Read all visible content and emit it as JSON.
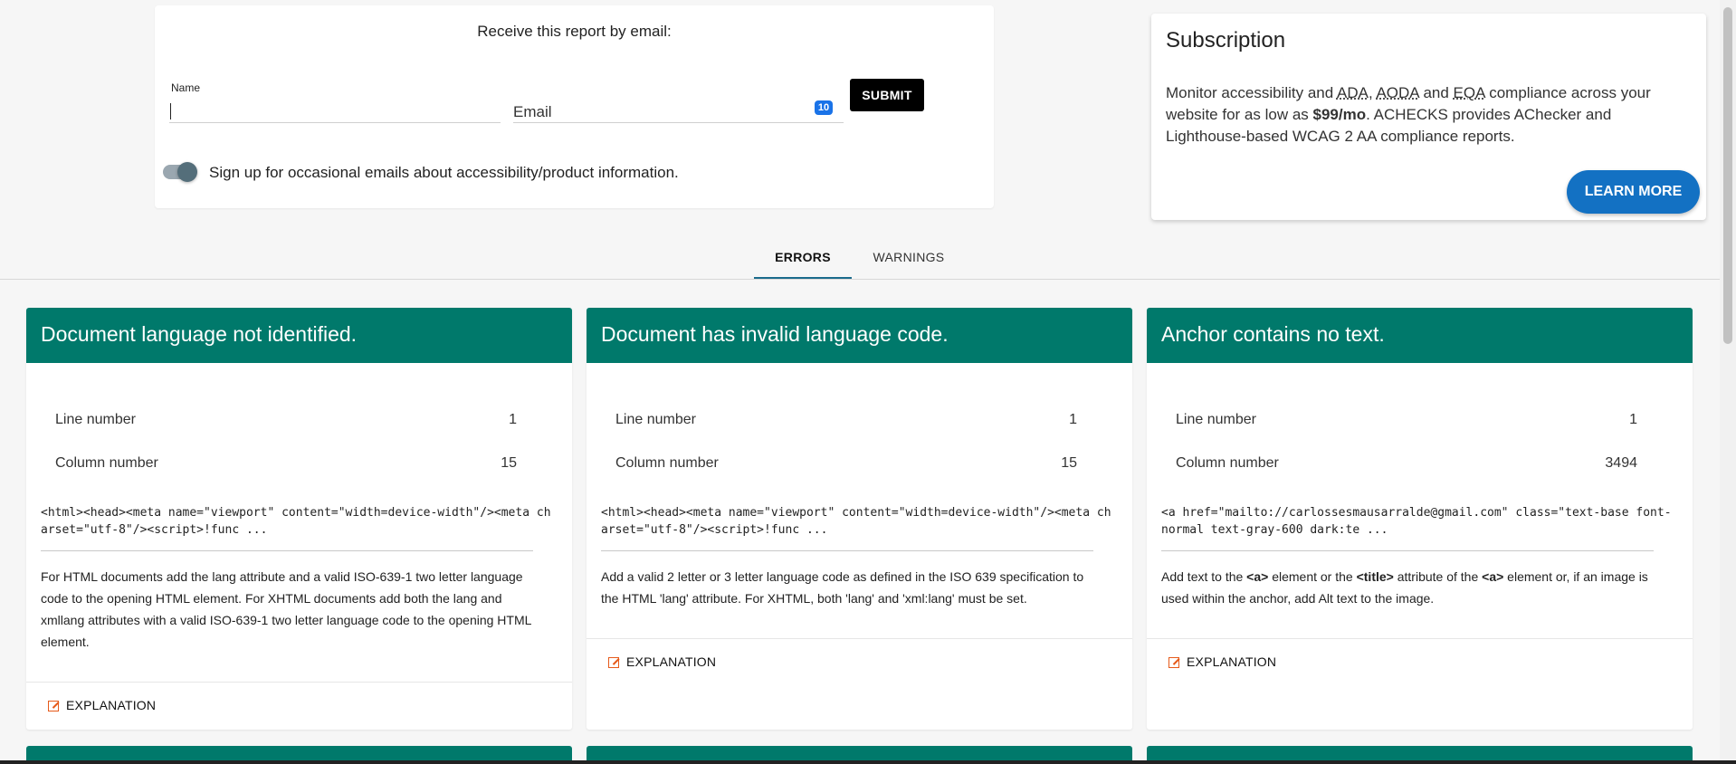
{
  "email_form": {
    "title": "Receive this report by email:",
    "name_label": "Name",
    "email_label": "Email",
    "email_badge": "10",
    "submit_label": "SUBMIT",
    "toggle_on": true,
    "toggle_text": "Sign up for occasional emails about accessibility/product information."
  },
  "subscription": {
    "title": "Subscription",
    "text_1": "Monitor accessibility and ",
    "abbr_ada": "ADA",
    "text_2": ", ",
    "abbr_aoda": "AODA",
    "text_3": " and ",
    "abbr_eqa": "EQA",
    "text_4": " compliance across your website for as low as ",
    "price": "$99/mo",
    "text_5": ". ACHECKS provides AChecker and Lighthouse-based WCAG 2 AA compliance reports.",
    "button_label": "LEARN MORE",
    "button_color": "#1371c3"
  },
  "tabs": [
    {
      "label": "ERRORS",
      "active": true
    },
    {
      "label": "WARNINGS",
      "active": false
    }
  ],
  "errors": [
    {
      "title": "Document language not identified.",
      "line_label": "Line number",
      "line_value": "1",
      "column_label": "Column number",
      "column_value": "15",
      "code": "<html><head><meta name=\"viewport\" content=\"width=device-width\"/><meta charset=\"utf-8\"/><script>!func ...",
      "description": "For HTML documents add the lang attribute and a valid ISO-639-1 two letter language code to the opening HTML element. For XHTML documents add both the lang and xmllang attributes with a valid ISO-639-1 two letter language code to the opening HTML element.",
      "explanation_label": "EXPLANATION"
    },
    {
      "title": "Document has invalid language code.",
      "line_label": "Line number",
      "line_value": "1",
      "column_label": "Column number",
      "column_value": "15",
      "code": "<html><head><meta name=\"viewport\" content=\"width=device-width\"/><meta charset=\"utf-8\"/><script>!func ...",
      "description": "Add a valid 2 letter or 3 letter language code as defined in the ISO 639 specification to the HTML 'lang' attribute. For XHTML, both 'lang' and 'xml:lang' must be set.",
      "explanation_label": "EXPLANATION"
    },
    {
      "title": "Anchor contains no text.",
      "line_label": "Line number",
      "line_value": "1",
      "column_label": "Column number",
      "column_value": "3494",
      "code": "<a href=\"mailto://carlossesmausarralde@gmail.com\" class=\"text-base font-normal text-gray-600 dark:te ...",
      "desc_1": "Add text to the ",
      "desc_a1": "<a>",
      "desc_2": " element or the ",
      "desc_title": "<title>",
      "desc_3": " attribute of the ",
      "desc_a2": "<a>",
      "desc_4": " element or, if an image is used within the anchor, add Alt text to the image.",
      "explanation_label": "EXPLANATION"
    }
  ],
  "colors": {
    "card_header": "#00796b",
    "explanation_icon": "#e65a1a",
    "tab_indicator": "#1a6b8c"
  }
}
